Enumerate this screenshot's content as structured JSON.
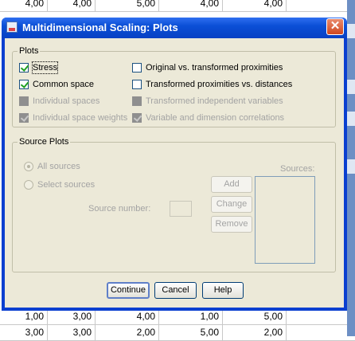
{
  "background_sheet": {
    "top_row": [
      "4,00",
      "4,00",
      "5,00",
      "4,00",
      "4,00"
    ],
    "row_a": [
      "1,00",
      "3,00",
      "4,00",
      "1,00",
      "5,00"
    ],
    "row_b": [
      "3,00",
      "3,00",
      "2,00",
      "5,00",
      "2,00"
    ]
  },
  "dialog": {
    "title": "Multidimensional Scaling: Plots",
    "close_symbol": "✕",
    "plots_group": {
      "label": "Plots",
      "left": [
        {
          "label": "Stress",
          "checked": true,
          "enabled": true
        },
        {
          "label": "Common space",
          "checked": true,
          "enabled": true
        },
        {
          "label": "Individual spaces",
          "checked": false,
          "enabled": false
        },
        {
          "label": "Individual space weights",
          "checked": true,
          "enabled": false
        }
      ],
      "right": [
        {
          "label": "Original vs. transformed proximities",
          "checked": false,
          "enabled": true
        },
        {
          "label": "Transformed proximities vs. distances",
          "checked": false,
          "enabled": true
        },
        {
          "label": "Transformed independent variables",
          "checked": false,
          "enabled": false
        },
        {
          "label": "Variable and dimension correlations",
          "checked": true,
          "enabled": false
        }
      ]
    },
    "source_group": {
      "label": "Source Plots",
      "all_sources": "All sources",
      "select_sources": "Select sources",
      "source_number_label": "Source number:",
      "sources_label": "Sources:",
      "add": "Add",
      "change": "Change",
      "remove": "Remove"
    },
    "buttons": {
      "continue": "Continue",
      "cancel": "Cancel",
      "help": "Help"
    }
  }
}
